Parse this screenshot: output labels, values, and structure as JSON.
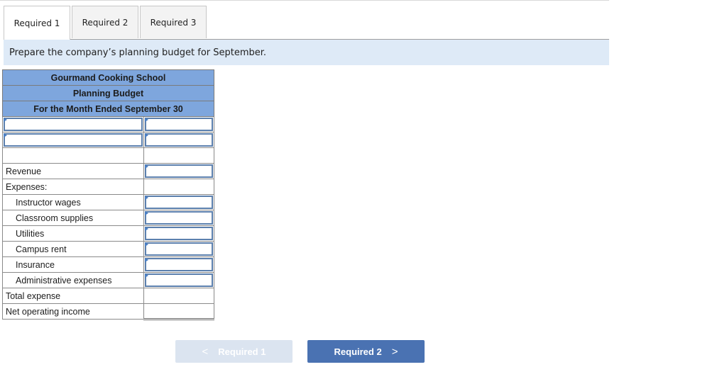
{
  "tabs": [
    {
      "label": "Required 1",
      "active": true
    },
    {
      "label": "Required 2",
      "active": false
    },
    {
      "label": "Required 3",
      "active": false
    }
  ],
  "instruction": "Prepare the company’s planning budget for September.",
  "budget": {
    "company": "Gourmand Cooking School",
    "title": "Planning Budget",
    "period": "For the Month Ended September 30",
    "input_rows": [
      {
        "label": "",
        "value": ""
      },
      {
        "label": "",
        "value": ""
      }
    ],
    "rows": [
      {
        "label": "Revenue",
        "value": ""
      },
      {
        "label": "Expenses:",
        "value": ""
      },
      {
        "label": "Instructor wages",
        "value": ""
      },
      {
        "label": "Classroom supplies",
        "value": ""
      },
      {
        "label": "Utilities",
        "value": ""
      },
      {
        "label": "Campus rent",
        "value": ""
      },
      {
        "label": "Insurance",
        "value": ""
      },
      {
        "label": "Administrative expenses",
        "value": ""
      },
      {
        "label": "Total expense",
        "value": ""
      },
      {
        "label": "Net operating income",
        "value": ""
      }
    ]
  },
  "nav": {
    "prev_label": "Required 1",
    "next_label": "Required 2",
    "prev_icon": "chevron-left-icon",
    "next_icon": "chevron-right-icon",
    "prev_chevron": "<",
    "next_chevron": ">"
  },
  "colors": {
    "header_blue": "#7ea6dd",
    "instruction_bg": "#deeaf7",
    "next_button": "#4a72b2",
    "prev_button_disabled": "#dbe4f0"
  }
}
